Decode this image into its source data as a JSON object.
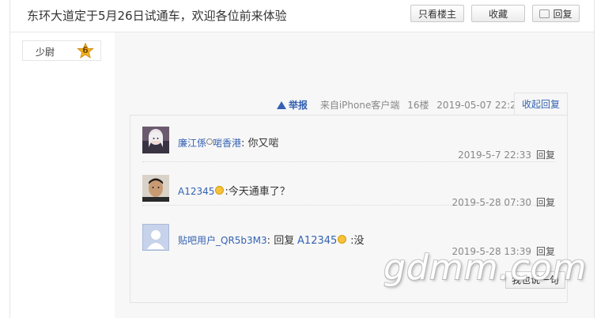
{
  "thread": {
    "title": "东环大道定于5月26日试通车，欢迎各位前来体验",
    "buttons": {
      "only_op": "只看楼主",
      "favorite": "收藏",
      "reply": "回复"
    }
  },
  "author": {
    "rank_label": "少尉",
    "rank_level": "6"
  },
  "post_meta": {
    "report": "举报",
    "source": "来自iPhone客户端",
    "floor": "16楼",
    "datetime": "2019-05-07 22:21",
    "collapse_label": "收起回复"
  },
  "replies": [
    {
      "user": "廉江係",
      "user_suffix": "啱香港",
      "content": "你又啱",
      "time": "2019-5-7 22:33",
      "reply_label": "回复",
      "avatar": "anime-girl-avatar"
    },
    {
      "user": "A12345",
      "content": "今天通車了？",
      "time": "2019-5-28 07:30",
      "reply_label": "回复",
      "avatar": "man-photo-avatar"
    },
    {
      "user": "贴吧用户_QR5b3M3",
      "content_prefix": "回复",
      "mention": "A12345",
      "content": ":没",
      "time": "2019-5-28 13:39",
      "reply_label": "回复",
      "avatar": "default-user-avatar"
    }
  ],
  "i_say_button": "我也说一句",
  "watermark": "gdmm.com",
  "colors": {
    "link": "#3462b2",
    "muted": "#888888",
    "panel": "#f7f7f7"
  }
}
